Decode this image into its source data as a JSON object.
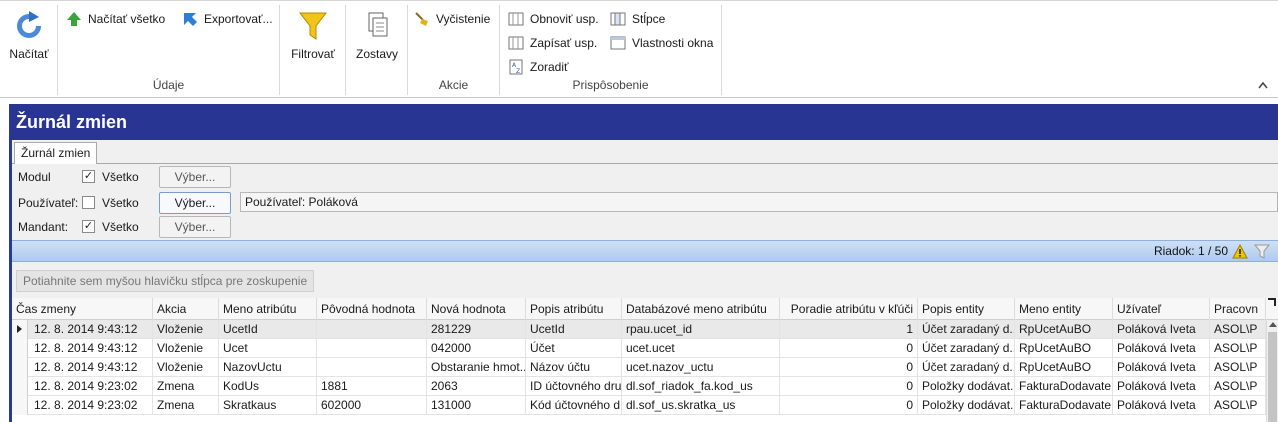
{
  "ribbon": {
    "load": "Načítať",
    "load_all": "Načítať všetko",
    "export": "Exportovať...",
    "filter": "Filtrovať",
    "reports": "Zostavy",
    "clear": "Vyčistenie",
    "refresh_settings": "Obnoviť usp.",
    "save_settings": "Zapísať usp.",
    "sort": "Zoradiť",
    "columns": "Stĺpce",
    "window_props": "Vlastnosti okna",
    "group_data": "Údaje",
    "group_actions": "Akcie",
    "group_customize": "Prispôsobenie"
  },
  "window": {
    "title": "Žurnál zmien",
    "tab": "Žurnál zmien"
  },
  "filters": {
    "module_label": "Modul",
    "user_label": "Používateľ:",
    "client_label": "Mandant:",
    "all_label": "Všetko",
    "choose_label": "Výber...",
    "user_value": "Používateľ: Poláková",
    "module_checked": "✓",
    "user_checked": "",
    "client_checked": "✓"
  },
  "status": {
    "row_info": "Riadok: 1 / 50"
  },
  "group_hint": "Potiahnite sem myšou hlavičku stĺpca pre zoskupenie",
  "grid": {
    "columns": [
      "Čas zmeny",
      "Akcia",
      "Meno atribútu",
      "Pôvodná hodnota",
      "Nová hodnota",
      "Popis atribútu",
      "Databázové meno atribútu",
      "Poradie atribútu v kľúči",
      "Popis entity",
      "Meno entity",
      "Užívateľ",
      "Pracovn"
    ],
    "rows": [
      [
        "12. 8. 2014 9:43:12",
        "Vloženie",
        "UcetId",
        "",
        "281229",
        "UcetId",
        "rpau.ucet_id",
        "1",
        "Účet zaradaný d...",
        "RpUcetAuBO",
        "Poláková Iveta",
        "ASOL\\P"
      ],
      [
        "12. 8. 2014 9:43:12",
        "Vloženie",
        "Ucet",
        "",
        "042000",
        "Účet",
        "ucet.ucet",
        "0",
        "Účet zaradaný d...",
        "RpUcetAuBO",
        "Poláková Iveta",
        "ASOL\\P"
      ],
      [
        "12. 8. 2014 9:43:12",
        "Vloženie",
        "NazovUctu",
        "",
        "Obstaranie hmot...",
        "Názov účtu",
        "ucet.nazov_uctu",
        "0",
        "Účet zaradaný d...",
        "RpUcetAuBO",
        "Poláková Iveta",
        "ASOL\\P"
      ],
      [
        "12. 8. 2014 9:23:02",
        "Zmena",
        "KodUs",
        "1881",
        "2063",
        "ID účtovného dru...",
        "dl.sof_riadok_fa.kod_us",
        "0",
        "Položky dodávat...",
        "FakturaDodavate...",
        "Poláková Iveta",
        "ASOL\\P"
      ],
      [
        "12. 8. 2014 9:23:02",
        "Zmena",
        "Skratkaus",
        "602000",
        "131000",
        "Kód účtovného d...",
        "dl.sof_us.skratka_us",
        "0",
        "Položky dodávat...",
        "FakturaDodavate...",
        "Poláková Iveta",
        "ASOL\\P"
      ]
    ]
  }
}
